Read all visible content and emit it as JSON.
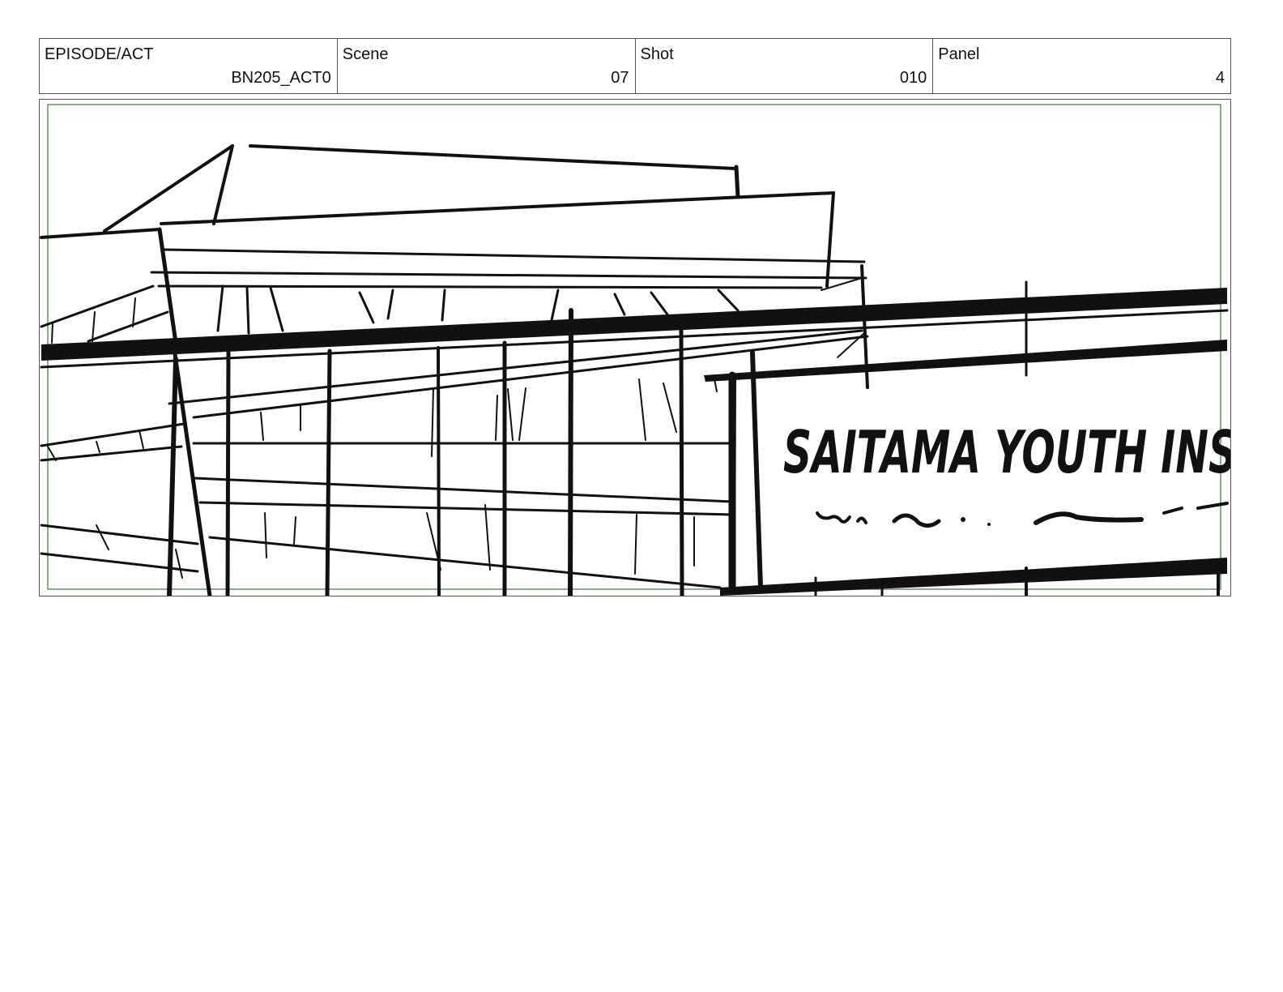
{
  "header": {
    "episode": {
      "label": "EPISODE/ACT",
      "value": "BN205_ACT0"
    },
    "scene": {
      "label": "Scene",
      "value": "07"
    },
    "shot": {
      "label": "Shot",
      "value": "010"
    },
    "panel": {
      "label": "Panel",
      "value": "4"
    }
  },
  "drawing": {
    "ink_color": "#111111",
    "safe_area_color": "#3a7a3a",
    "sign_lettering": "SAITAMA YOUTH INS"
  }
}
